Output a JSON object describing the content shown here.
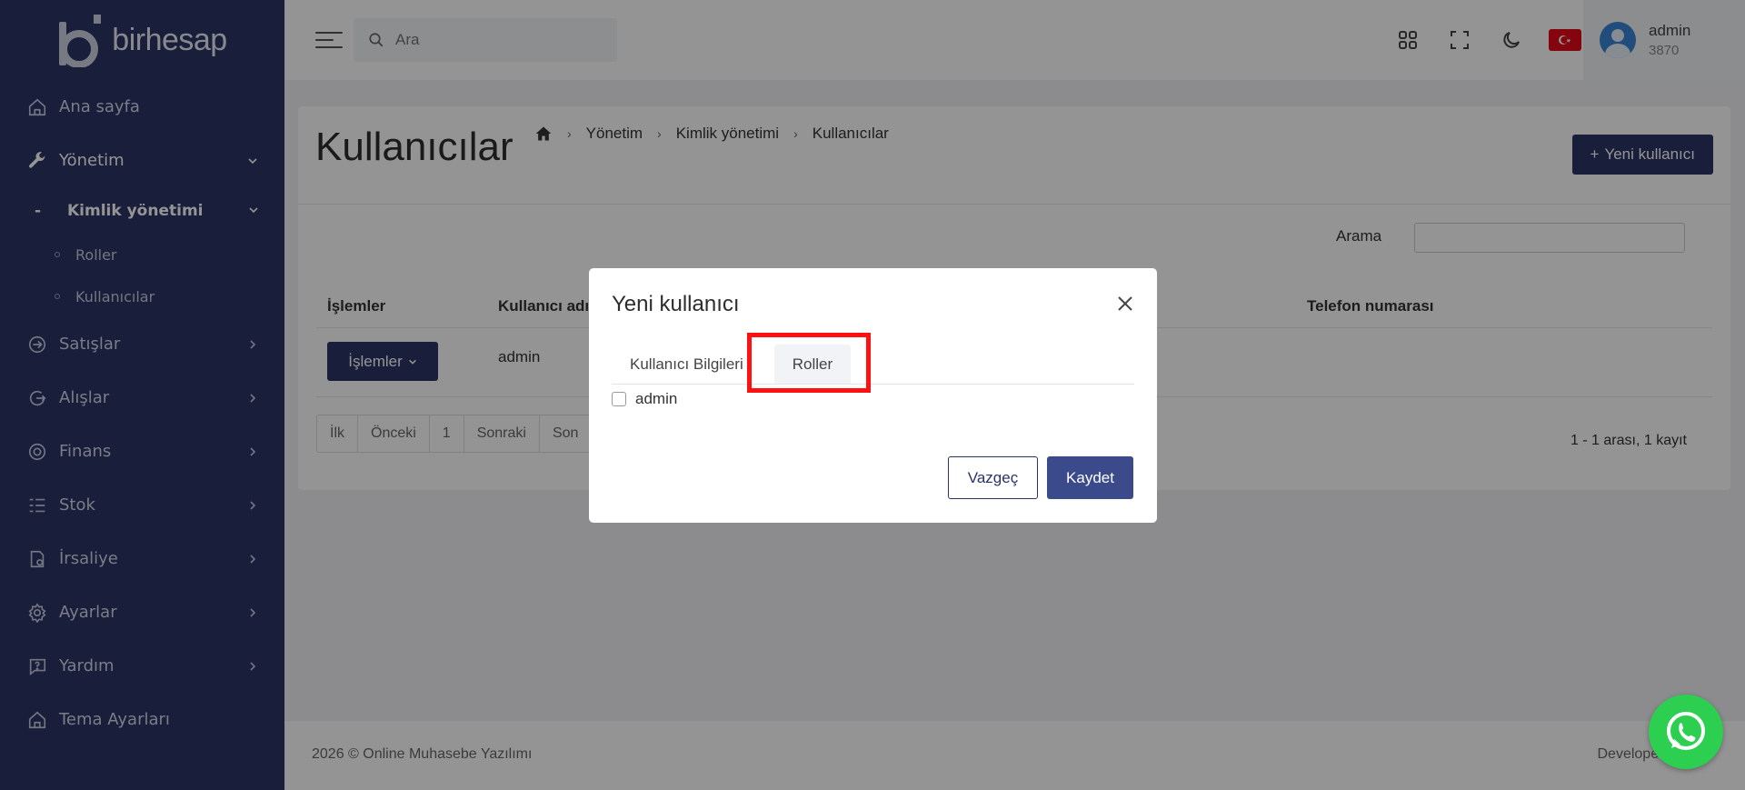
{
  "brand": {
    "name": "birhesap"
  },
  "sidebar": {
    "items": [
      {
        "label": "Ana sayfa",
        "icon": "home-icon"
      },
      {
        "label": "Yönetim",
        "icon": "wrench-icon"
      },
      {
        "label": "Satışlar",
        "icon": "sign-in-icon"
      },
      {
        "label": "Alışlar",
        "icon": "sign-out-icon"
      },
      {
        "label": "Finans",
        "icon": "coin-icon"
      },
      {
        "label": "Stok",
        "icon": "list-icon"
      },
      {
        "label": "İrsaliye",
        "icon": "document-icon"
      },
      {
        "label": "Ayarlar",
        "icon": "gear-icon"
      },
      {
        "label": "Yardım",
        "icon": "help-icon"
      },
      {
        "label": "Tema Ayarları",
        "icon": "home-icon"
      }
    ],
    "sub": {
      "label": "Kimlik yönetimi",
      "children": [
        "Roller",
        "Kullanıcılar"
      ]
    }
  },
  "topbar": {
    "search_placeholder": "Ara",
    "user": {
      "name": "admin",
      "id": "3870"
    }
  },
  "page": {
    "title": "Kullanıcılar",
    "breadcrumb": [
      "Yönetim",
      "Kimlik yönetimi",
      "Kullanıcılar"
    ],
    "new_button": "Yeni kullanıcı",
    "search_label": "Arama",
    "columns": [
      "İşlemler",
      "Kullanıcı adı",
      "Telefon numarası"
    ],
    "row": {
      "ops_button": "İşlemler",
      "username": "admin"
    },
    "pagination": [
      "İlk",
      "Önceki",
      "1",
      "Sonraki",
      "Son"
    ],
    "records": "1 - 1 arası, 1 kayıt"
  },
  "footer": {
    "left": "2026 © Online Muhasebe Yazılımı",
    "right": "Developed"
  },
  "modal": {
    "title": "Yeni kullanıcı",
    "tabs": [
      "Kullanıcı Bilgileri",
      "Roller"
    ],
    "roles": [
      "admin"
    ],
    "cancel": "Vazgeç",
    "save": "Kaydet"
  },
  "colors": {
    "sidebar": "#2b3467",
    "primary": "#2b3467",
    "highlight": "#ff1111",
    "whatsapp": "#2ccf4f"
  }
}
